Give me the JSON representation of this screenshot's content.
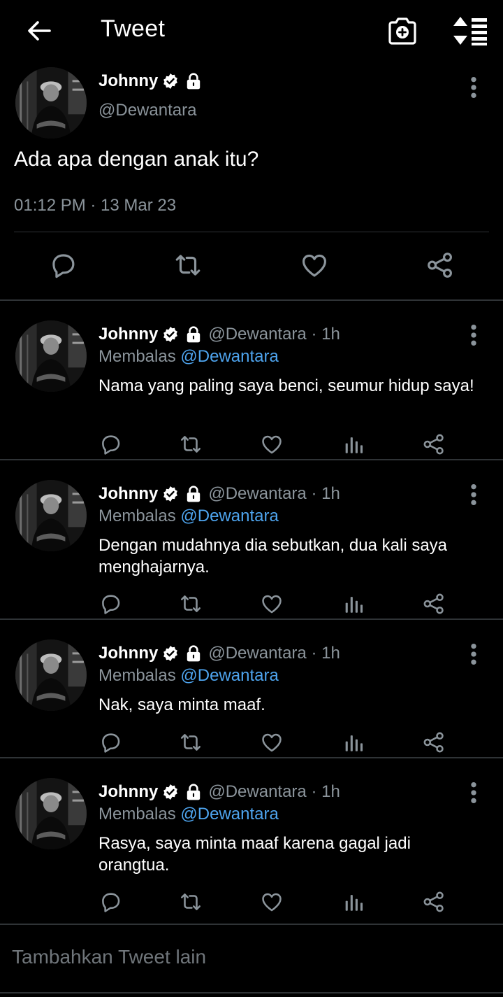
{
  "header": {
    "title": "Tweet",
    "back_icon": "arrow-left-icon",
    "camera_icon": "camera-plus-icon",
    "sort_icon": "sort-list-icon"
  },
  "colors": {
    "background": "#000000",
    "text": "#ffffff",
    "muted": "#8b949b",
    "mention": "#4ea4ee",
    "divider": "#2f3336"
  },
  "main_tweet": {
    "name": "Johnny",
    "handle": "@Dewantara",
    "text": "Ada apa dengan anak itu?",
    "timestamp": "01:12 PM · 13 Mar 23",
    "actions": [
      "reply-icon",
      "retweet-icon",
      "like-icon",
      "share-icon"
    ]
  },
  "replies": [
    {
      "name": "Johnny",
      "handle_time": "@Dewantara · 1h",
      "reply_prefix": "Membalas",
      "mention": "@Dewantara",
      "text": "Nama yang paling saya benci, seumur hidup saya!"
    },
    {
      "name": "Johnny",
      "handle_time": "@Dewantara · 1h",
      "reply_prefix": "Membalas",
      "mention": "@Dewantara",
      "text": "Dengan mudahnya dia sebutkan, dua kali saya menghajarnya."
    },
    {
      "name": "Johnny",
      "handle_time": "@Dewantara · 1h",
      "reply_prefix": "Membalas",
      "mention": "@Dewantara",
      "text": "Nak, saya minta maaf."
    },
    {
      "name": "Johnny",
      "handle_time": "@Dewantara · 1h",
      "reply_prefix": "Membalas",
      "mention": "@Dewantara",
      "text": "Rasya, saya minta maaf karena gagal jadi orangtua."
    }
  ],
  "compose": {
    "placeholder": "Tambahkan Tweet lain"
  }
}
